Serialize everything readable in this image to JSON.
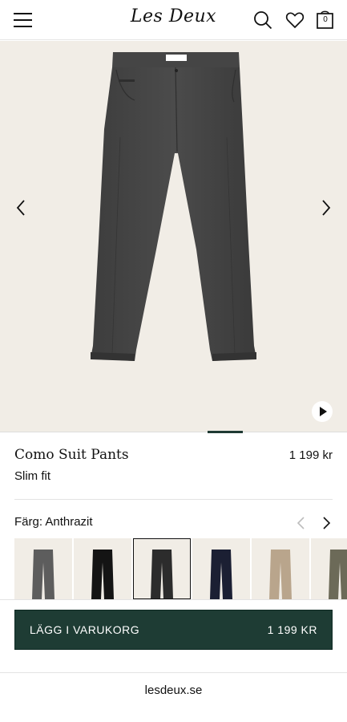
{
  "header": {
    "logo_text": "Les Deux",
    "cart_count": "0"
  },
  "gallery": {
    "prev_label": "‹",
    "next_label": "›"
  },
  "product": {
    "title": "Como Suit Pants",
    "price": "1 199 kr",
    "fit": "Slim fit"
  },
  "color": {
    "label": "Färg: Anthrazit",
    "swatches": [
      {
        "name": "grey",
        "color": "#5d5d5d"
      },
      {
        "name": "black",
        "color": "#141414"
      },
      {
        "name": "anthrazit",
        "color": "#2c2c2c",
        "selected": true
      },
      {
        "name": "navy",
        "color": "#1b1f33"
      },
      {
        "name": "beige",
        "color": "#b9a58c"
      },
      {
        "name": "olive",
        "color": "#6c6a58"
      }
    ]
  },
  "cart_button": {
    "label": "LÄGG I VARUKORG",
    "price": "1 199 KR"
  },
  "footer": {
    "domain": "lesdeux.se"
  },
  "colors": {
    "accent": "#1e3c34",
    "background_gallery": "#f1ede6"
  }
}
